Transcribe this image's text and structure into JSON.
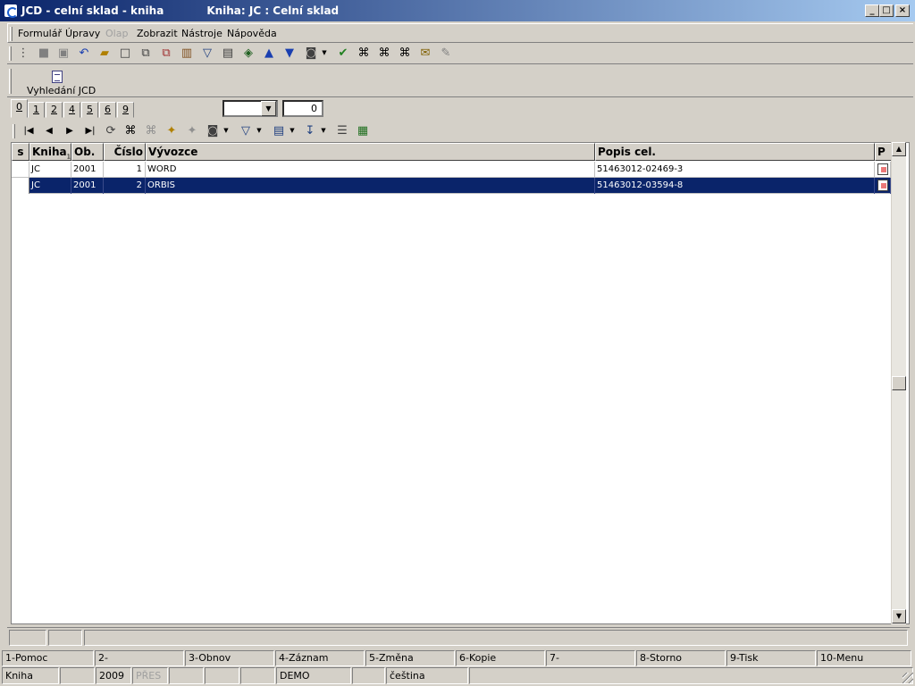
{
  "window": {
    "title": "JCD - celní sklad - kniha",
    "subtitle": "Kniha: JC : Celní sklad"
  },
  "menu": [
    {
      "label": "Formulář",
      "enabled": true
    },
    {
      "label": "Úpravy",
      "enabled": true
    },
    {
      "label": "Olap",
      "enabled": false
    },
    {
      "label": "Zobrazit",
      "enabled": true
    },
    {
      "label": "Nástroje",
      "enabled": true
    },
    {
      "label": "Nápověda",
      "enabled": true
    }
  ],
  "toolbar2": {
    "vyhledani_label": "Vyhledání JCD"
  },
  "tabs": [
    "0",
    "1",
    "2",
    "4",
    "5",
    "6",
    "9"
  ],
  "filter": {
    "selected": "",
    "count": "0"
  },
  "grid": {
    "columns": [
      "s",
      "Kniha",
      "Ob.",
      "Číslo",
      "Vývozce",
      "Popis cel.",
      "P"
    ],
    "sort_marker": "1",
    "rows": [
      {
        "s": "",
        "kniha": "JC",
        "ob": "2001",
        "cislo": "1",
        "vyvozce": "WORD",
        "popis": "51463012-02469-3",
        "selected": false
      },
      {
        "s": "",
        "kniha": "JC",
        "ob": "2001",
        "cislo": "2",
        "vyvozce": "ORBIS",
        "popis": "51463012-03594-8",
        "selected": true
      }
    ]
  },
  "function_keys": [
    "1-Pomoc",
    "2-",
    "3-Obnov",
    "4-Záznam",
    "5-Změna",
    "6-Kopie",
    "7-",
    "8-Storno",
    "9-Tisk",
    "10-Menu"
  ],
  "status": {
    "book": "Kniha",
    "year": "2009",
    "mode": "PŘES",
    "company": "DEMO",
    "language": "čeština"
  },
  "colors": {
    "titlebar": "#0a246a",
    "selection": "#0a246a",
    "face": "#d4d0c8"
  }
}
